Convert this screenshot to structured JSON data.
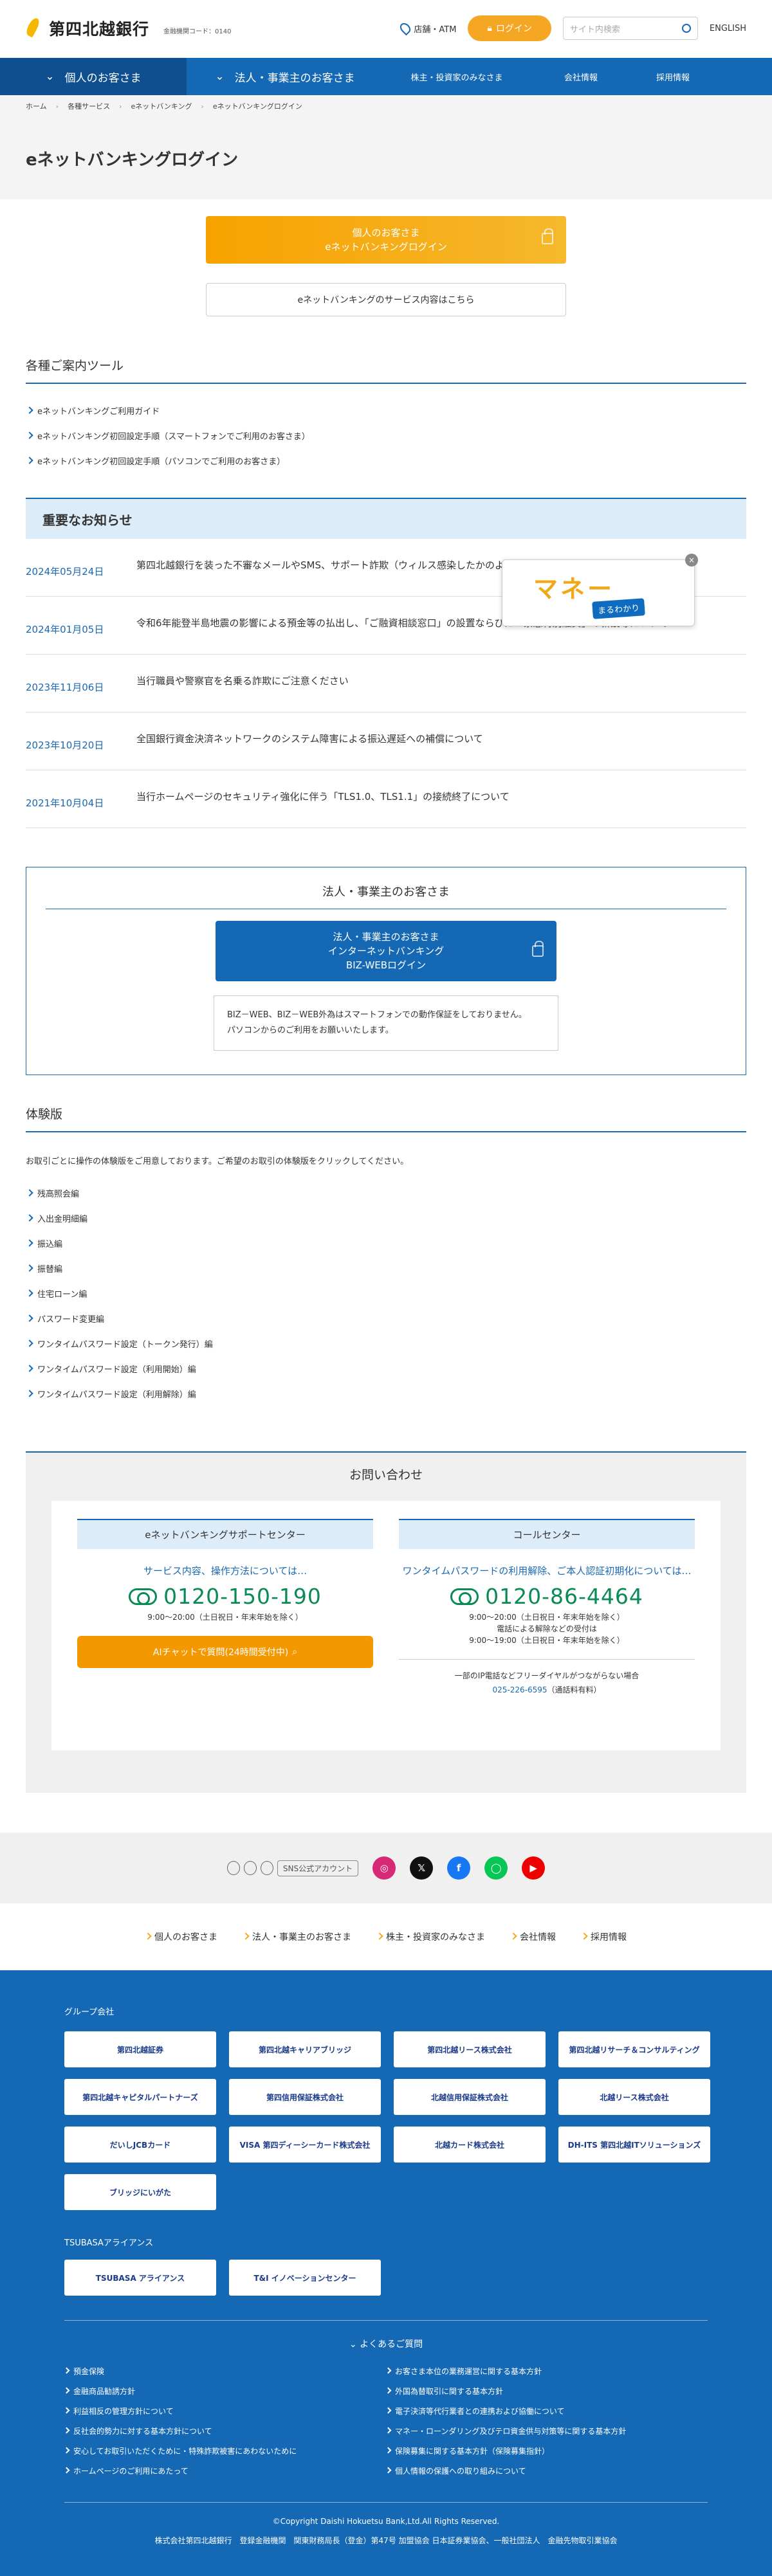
{
  "header": {
    "bank_name": "第四北越銀行",
    "bank_code": "金融機関コード：0140",
    "atm_label": "店舗・ATM",
    "login_label": "ログイン",
    "search_placeholder": "サイト内検索",
    "english_label": "ENGLISH"
  },
  "gnav": {
    "personal": "個人のお客さま",
    "corporate": "法人・事業主のお客さま",
    "investor": "株主・投資家のみなさま",
    "company": "会社情報",
    "recruit": "採用情報"
  },
  "breadcrumb": [
    "ホーム",
    "各種サービス",
    "eネットバンキング",
    "eネットバンキングログイン"
  ],
  "page_title": "eネットバンキングログイン",
  "login": {
    "personal_btn_line1": "個人のお客さま",
    "personal_btn_line2": "eネットバンキングログイン",
    "service_link": "eネットバンキングのサービス内容はこちら"
  },
  "tools": {
    "heading": "各種ご案内ツール",
    "items": [
      "eネットバンキングご利用ガイド",
      "eネットバンキング初回設定手順（スマートフォンでご利用のお客さま）",
      "eネットバンキング初回設定手順（パソコンでご利用のお客さま）"
    ]
  },
  "news": {
    "heading": "重要なお知らせ",
    "items": [
      {
        "date": "2024年05月24日",
        "text": "第四北越銀行を装った不審なメールやSMS、サポート詐欺（ウィルス感染したかのような偽の画面表示）にご注意ください"
      },
      {
        "date": "2024年01月05日",
        "text": "令和6年能登半島地震の影響による預金等の払出し、「ご融資相談窓口」の設置ならびに「緊急特別融資」の新設等について"
      },
      {
        "date": "2023年11月06日",
        "text": "当行職員や警察官を名乗る詐欺にご注意ください"
      },
      {
        "date": "2023年10月20日",
        "text": "全国銀行資金決済ネットワークのシステム障害による振込遅延への補償について"
      },
      {
        "date": "2021年10月04日",
        "text": "当行ホームページのセキュリティ強化に伴う「TLS1.0、TLS1.1」の接続終了について"
      }
    ]
  },
  "popup": {
    "title": "マネー",
    "sub": "まるわかり",
    "close": "×"
  },
  "corporate": {
    "heading": "法人・事業主のお客さま",
    "btn_line1": "法人・事業主のお客さま",
    "btn_line2": "インターネットバンキング",
    "btn_line3": "BIZ-WEBログイン",
    "note_line1": "BIZ－WEB、BIZ－WEB外為はスマートフォンでの動作保証をしておりません。",
    "note_line2": "パソコンからのご利用をお願いいたします。"
  },
  "trial": {
    "heading": "体験版",
    "desc": "お取引ごとに操作の体験版をご用意しております。ご希望のお取引の体験版をクリックしてください。",
    "items": [
      "残高照会編",
      "入出金明細編",
      "振込編",
      "振替編",
      "住宅ローン編",
      "パスワード変更編",
      "ワンタイムパスワード設定（トークン発行）編",
      "ワンタイムパスワード設定（利用開始）編",
      "ワンタイムパスワード設定（利用解除）編"
    ]
  },
  "contact": {
    "heading": "お問い合わせ",
    "support": {
      "title": "eネットバンキングサポートセンター",
      "desc": "サービス内容、操作方法については…",
      "tel": "0120-150-190",
      "hours": "9:00～20:00（土日祝日・年末年始を除く）",
      "chat": "AIチャットで質問(24時間受付中)"
    },
    "call": {
      "title": "コールセンター",
      "desc": "ワンタイムパスワードの利用解除、ご本人認証初期化については…",
      "tel": "0120-86-4464",
      "hours1": "9:00～20:00（土日祝日・年末年始を除く）",
      "hours2": "電話による解除などの受付は",
      "hours3": "9:00～19:00（土日祝日・年末年始を除く）",
      "note1": "一部のIP電話などフリーダイヤルがつながらない場合",
      "note2": "025-226-6595",
      "note3": "（通話料有料）"
    }
  },
  "sns": {
    "label": "SNS公式アカウント"
  },
  "bottom_nav": [
    "個人のお客さま",
    "法人・事業主のお客さま",
    "株主・投資家のみなさま",
    "会社情報",
    "採用情報"
  ],
  "footer": {
    "group_title": "グループ会社",
    "group": [
      "第四北越証券",
      "第四北越キャリアブリッジ",
      "第四北越リース株式会社",
      "第四北越リサーチ＆コンサルティング",
      "第四北越キャピタルパートナーズ",
      "第四信用保証株式会社",
      "北越信用保証株式会社",
      "北越リース株式会社",
      "だいしJCBカード",
      "VISA 第四ディーシーカード株式会社",
      "北越カード株式会社",
      "DH-ITS 第四北越ITソリューションズ",
      "ブリッジにいがた"
    ],
    "tsubasa_title": "TSUBASAアライアンス",
    "tsubasa": [
      "TSUBASA アライアンス",
      "T&I イノベーションセンター"
    ],
    "faq_title": "よくあるご質問",
    "faq": [
      "預金保険",
      "お客さま本位の業務運営に関する基本方針",
      "金融商品勧誘方針",
      "外国為替取引に関する基本方針",
      "利益相反の管理方針について",
      "電子決済等代行業者との連携および協働について",
      "反社会的勢力に対する基本方針について",
      "マネー・ローンダリング及びテロ資金供与対策等に関する基本方針",
      "安心してお取引いただくために・特殊詐欺被害にあわないために",
      "保険募集に関する基本方針（保険募集指針）",
      "ホームページのご利用にあたって",
      "個人情報の保護への取り組みについて"
    ],
    "copyright": "©Copyright Daishi Hokuetsu Bank,Ltd.All Rights Reserved.",
    "registration": "株式会社第四北越銀行　登録金融機関　関東財務局長（登金）第47号 加盟協会 日本証券業協会、一般社団法人　金融先物取引業協会"
  },
  "colors": {
    "brand_blue": "#1468b4",
    "accent_orange": "#f5a623",
    "free_dial_green": "#0a8a54"
  }
}
